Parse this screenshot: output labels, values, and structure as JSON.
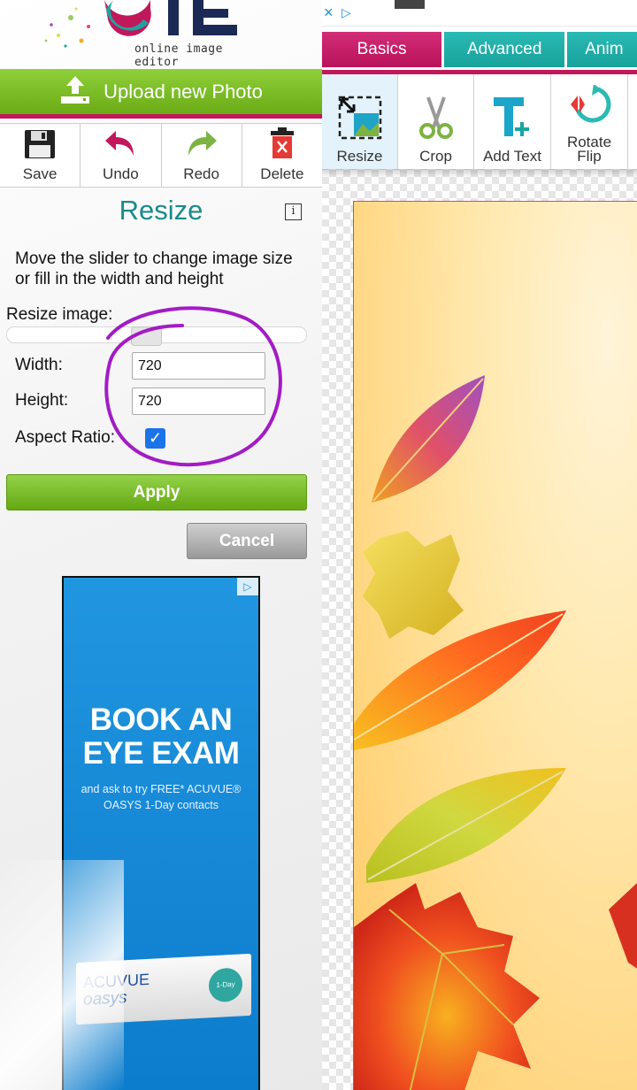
{
  "app": {
    "logo_text": "online image editor"
  },
  "upload": {
    "label": "Upload new Photo"
  },
  "toolbar": {
    "save": "Save",
    "undo": "Undo",
    "redo": "Redo",
    "delete": "Delete"
  },
  "panel": {
    "title": "Resize",
    "info": "i",
    "description": "Move the slider to change image size or fill in the width and height",
    "resize_label": "Resize image:",
    "width_label": "Width:",
    "width_value": "720",
    "height_label": "Height:",
    "height_value": "720",
    "aspect_label": "Aspect Ratio:",
    "aspect_checked": true,
    "apply": "Apply",
    "cancel": "Cancel"
  },
  "ad": {
    "headline": "BOOK AN EYE EXAM",
    "subline": "and ask to try FREE* ACUVUE® OASYS 1-Day contacts",
    "brand_line1": "ACUVUE",
    "brand_line2": "oasys",
    "product_badge": "1-Day"
  },
  "tabs": {
    "basics": "Basics",
    "advanced": "Advanced",
    "animation": "Anim"
  },
  "tools": {
    "resize": "Resize",
    "crop": "Crop",
    "add_text": "Add Text",
    "rotate_line1": "Rotate",
    "rotate_line2": "Flip"
  },
  "colors": {
    "accent_pink": "#c0185a",
    "teal": "#1a8a8a",
    "green": "#6aab16",
    "checkbox_blue": "#1a73e8",
    "annotation_purple": "#a21cc4"
  }
}
